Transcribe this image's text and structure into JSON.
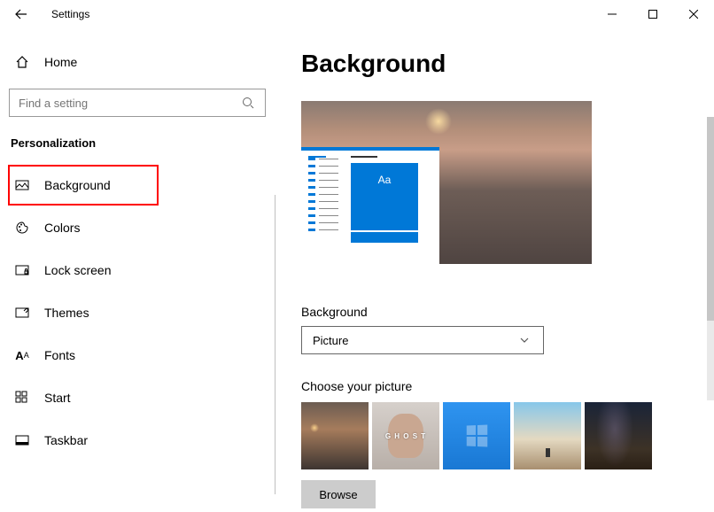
{
  "titlebar": {
    "title": "Settings"
  },
  "sidebar": {
    "home_label": "Home",
    "search_placeholder": "Find a setting",
    "section_title": "Personalization",
    "items": [
      {
        "label": "Background",
        "icon": "picture-icon",
        "selected": true
      },
      {
        "label": "Colors",
        "icon": "palette-icon"
      },
      {
        "label": "Lock screen",
        "icon": "lockscreen-icon"
      },
      {
        "label": "Themes",
        "icon": "themes-icon"
      },
      {
        "label": "Fonts",
        "icon": "fonts-icon"
      },
      {
        "label": "Start",
        "icon": "start-icon"
      },
      {
        "label": "Taskbar",
        "icon": "taskbar-icon"
      }
    ]
  },
  "content": {
    "page_title": "Background",
    "preview_sample_text": "Aa",
    "background_label": "Background",
    "background_value": "Picture",
    "choose_label": "Choose your picture",
    "browse_label": "Browse"
  }
}
